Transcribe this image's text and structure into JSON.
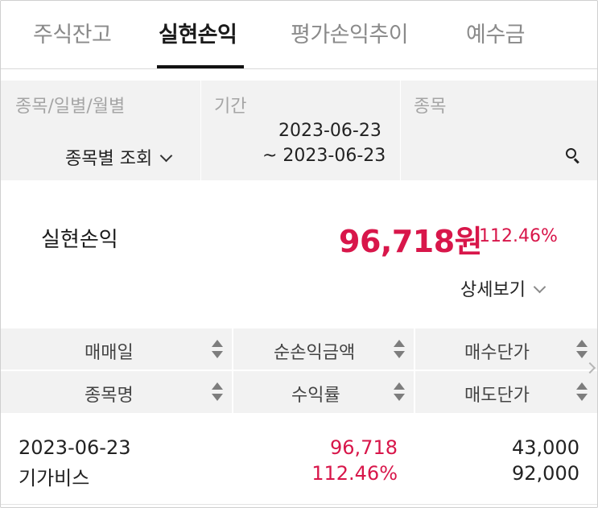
{
  "tabs": [
    {
      "label": "주식잔고"
    },
    {
      "label": "실현손익",
      "active": true
    },
    {
      "label": "평가손익추이"
    },
    {
      "label": "예수금"
    }
  ],
  "filters": {
    "type": {
      "label": "종목/일별/월별",
      "value": "종목별 조회"
    },
    "period": {
      "label": "기간",
      "from": "2023-06-23",
      "to": "~ 2023-06-23"
    },
    "stock": {
      "label": "종목",
      "icon": "search-icon"
    }
  },
  "summary": {
    "label": "실현손익",
    "amount": "96,718원",
    "rate": "112.46%",
    "detail_label": "상세보기"
  },
  "table": {
    "headers_row1": [
      "매매일",
      "순손익금액",
      "매수단가"
    ],
    "headers_row2": [
      "종목명",
      "수익률",
      "매도단가"
    ],
    "rows": [
      {
        "date": "2023-06-23",
        "name": "기가비스",
        "net_profit": "96,718",
        "return_rate": "112.46%",
        "buy_price": "43,000",
        "sell_price": "92,000"
      }
    ]
  },
  "colors": {
    "accent_red": "#d8164a",
    "filter_bg": "#f2f2f2",
    "active_tab": "#111111"
  }
}
